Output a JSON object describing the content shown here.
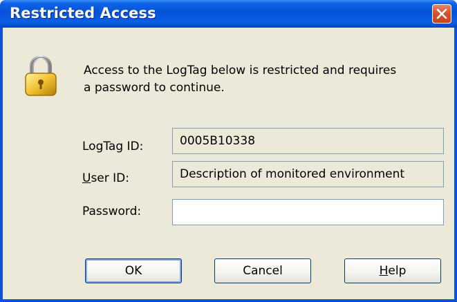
{
  "dialog": {
    "title": "Restricted Access",
    "message_line1": "Access to the LogTag below is restricted and requires",
    "message_line2": "a password to continue."
  },
  "icons": {
    "close": "close-icon",
    "lock": "padlock-icon"
  },
  "fields": {
    "logtag_id": {
      "label": "LogTag ID:",
      "value": "0005B10338"
    },
    "user_id": {
      "label_accel": "U",
      "label_rest": "ser ID:",
      "value": "Description of monitored environment"
    },
    "password": {
      "label": "Password:",
      "value": ""
    }
  },
  "buttons": {
    "ok": "OK",
    "cancel": "Cancel",
    "help_accel": "H",
    "help_rest": "elp"
  },
  "colors": {
    "titlebar": "#0752d6",
    "client_bg": "#ece9d8",
    "close_button": "#d8542b",
    "field_border": "#7f9db9"
  }
}
